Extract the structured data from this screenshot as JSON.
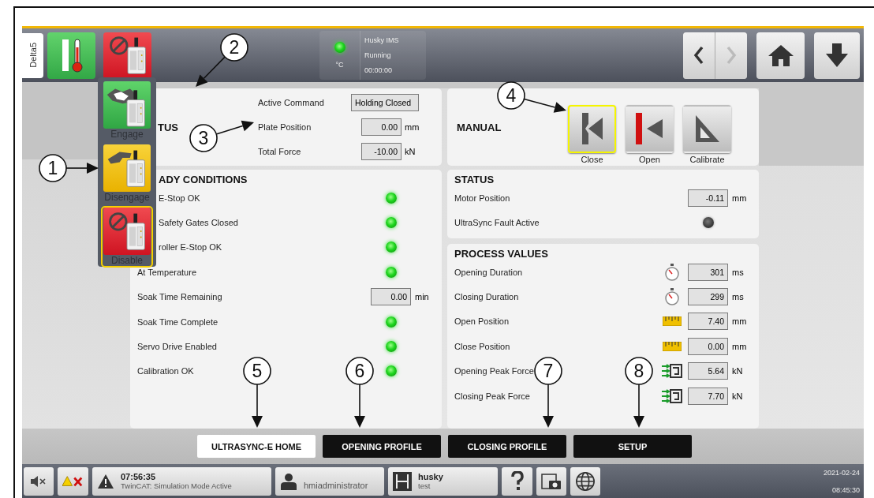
{
  "header": {
    "tab_label": "Delta5",
    "status_box": {
      "on": true,
      "unit": "°C",
      "lines": [
        "Husky IMS",
        "Running",
        "00:00:00"
      ]
    }
  },
  "popup_menu": {
    "items": [
      {
        "kind": "engage",
        "label": "Engage",
        "selected": false
      },
      {
        "kind": "disengage",
        "label": "Disengage",
        "selected": false
      },
      {
        "kind": "disable",
        "label": "Disable",
        "selected": true
      }
    ]
  },
  "status_panel": {
    "title": "TUS",
    "fields": [
      {
        "label": "Active Command",
        "value": "Holding Closed"
      },
      {
        "label": "Plate Position",
        "value": "0.00",
        "unit": "mm"
      },
      {
        "label": "Total Force",
        "value": "-10.00",
        "unit": "kN"
      }
    ]
  },
  "ready_conditions": {
    "title": "ADY CONDITIONS",
    "rows": [
      {
        "kind": "led",
        "label": "E-Stop OK",
        "on": true
      },
      {
        "kind": "led",
        "label": "Safety Gates Closed",
        "on": true
      },
      {
        "kind": "led",
        "label": "roller E-Stop OK",
        "on": true
      },
      {
        "kind": "led",
        "label": "At Temperature",
        "on": true
      },
      {
        "kind": "value",
        "label": "Soak Time Remaining",
        "value": "0.00",
        "unit": "min"
      },
      {
        "kind": "led",
        "label": "Soak Time Complete",
        "on": true
      },
      {
        "kind": "led",
        "label": "Servo Drive Enabled",
        "on": true
      },
      {
        "kind": "led",
        "label": "Calibration OK",
        "on": true
      }
    ]
  },
  "manual": {
    "title": "MANUAL",
    "buttons": [
      {
        "kind": "close",
        "label": "Close",
        "selected": true
      },
      {
        "kind": "open",
        "label": "Open",
        "selected": false
      },
      {
        "kind": "calibrate",
        "label": "Calibrate",
        "selected": false
      }
    ]
  },
  "status": {
    "title": "STATUS",
    "rows": [
      {
        "kind": "value",
        "label": "Motor Position",
        "value": "-0.11",
        "unit": "mm"
      },
      {
        "kind": "led",
        "label": "UltraSync Fault Active",
        "on": false
      }
    ]
  },
  "process_values": {
    "title": "PROCESS VALUES",
    "rows": [
      {
        "kind": "timer",
        "label": "Opening Duration",
        "value": "301",
        "unit": "ms"
      },
      {
        "kind": "timer",
        "label": "Closing Duration",
        "value": "299",
        "unit": "ms"
      },
      {
        "kind": "ruler",
        "label": "Open Position",
        "value": "7.40",
        "unit": "mm"
      },
      {
        "kind": "ruler",
        "label": "Close Position",
        "value": "0.00",
        "unit": "mm"
      },
      {
        "kind": "force",
        "label": "Opening Peak Force",
        "value": "5.64",
        "unit": "kN"
      },
      {
        "kind": "force",
        "label": "Closing Peak Force",
        "value": "7.70",
        "unit": "kN"
      }
    ]
  },
  "tabs": [
    {
      "label": "ULTRASYNC-E HOME",
      "selected": true
    },
    {
      "label": "OPENING PROFILE",
      "selected": false
    },
    {
      "label": "CLOSING PROFILE",
      "selected": false
    },
    {
      "label": "SETUP",
      "selected": false
    }
  ],
  "taskbar": {
    "alarm": {
      "time": "07:56:35",
      "message": "TwinCAT: Simulation Mode Active"
    },
    "user": "hmiadministrator",
    "project": {
      "name": "husky",
      "config": "test"
    },
    "date": "2021-02-24",
    "time": "08:45:30"
  },
  "callouts": [
    {
      "label": "1"
    },
    {
      "label": "2"
    },
    {
      "label": "3"
    },
    {
      "label": "4"
    },
    {
      "label": "5"
    },
    {
      "label": "6"
    },
    {
      "label": "7"
    },
    {
      "label": "8"
    }
  ]
}
